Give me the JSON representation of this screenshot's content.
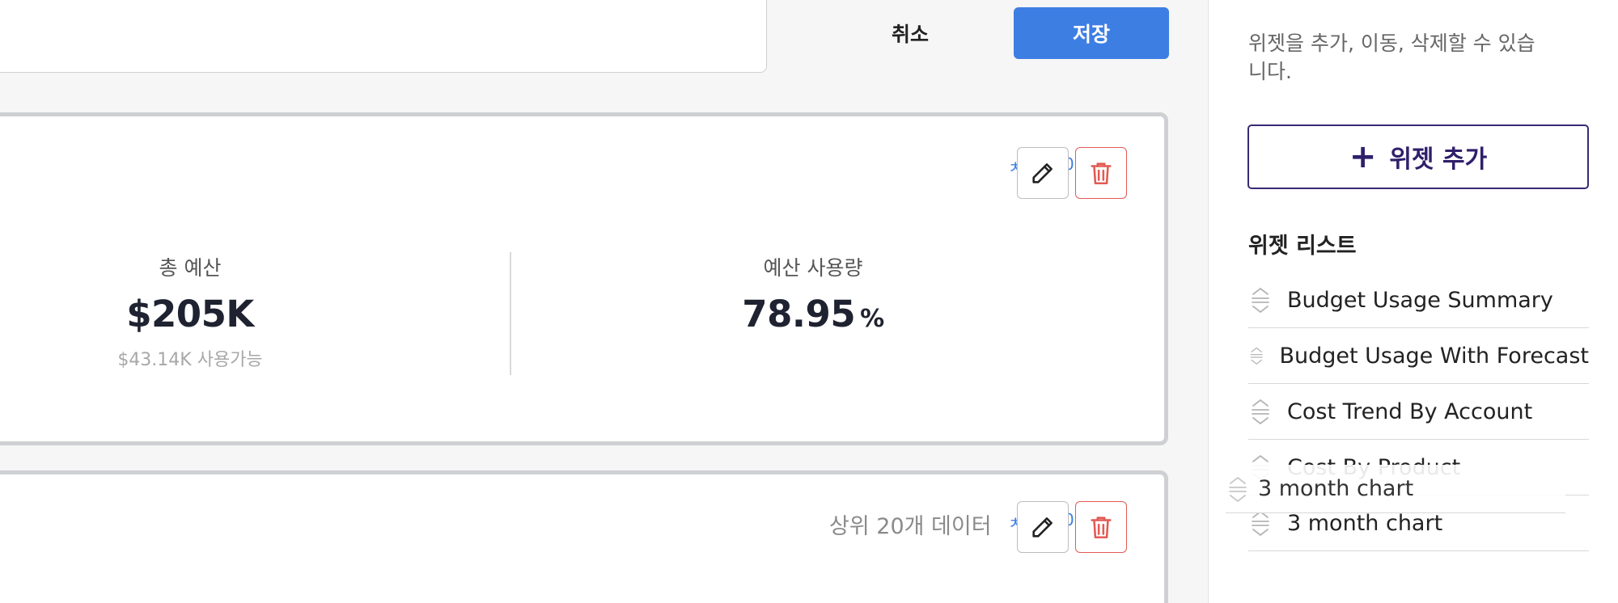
{
  "header": {
    "cancel_label": "취소",
    "save_label": "저장"
  },
  "widgets": [
    {
      "metrics": [
        {
          "label": "총 예산",
          "value": "$205K",
          "sub": "$43.14K 사용가능"
        },
        {
          "label": "예산 사용량",
          "value": "78.95",
          "unit": "%"
        }
      ],
      "peek_left": "ㅊ",
      "peek_right": "0"
    },
    {
      "top_n_label": "상위 20개 데이터",
      "peek_left": "ㅊ",
      "peek_right": "0"
    }
  ],
  "sidebar": {
    "help_text": "위젯을 추가, 이동, 삭제할 수 있습니다.",
    "add_widget_label": "위젯 추가",
    "list_title": "위젯 리스트",
    "items": [
      {
        "label": "Budget Usage Summary"
      },
      {
        "label": "Budget Usage With Forecast"
      },
      {
        "label": "Cost Trend By Account"
      },
      {
        "label": "Cost By Product"
      },
      {
        "label": "3 month chart"
      }
    ],
    "dragging_label": "3 month chart"
  },
  "colors": {
    "accent": "#3d7ee3",
    "danger": "#e25b54",
    "brand_purple": "#2f1f6b"
  }
}
